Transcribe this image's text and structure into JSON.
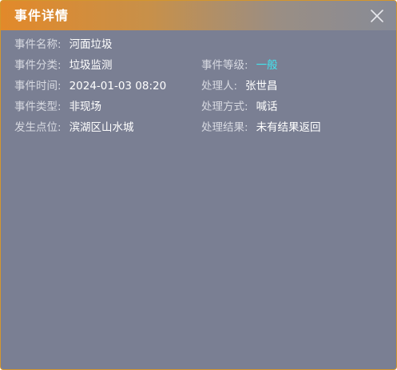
{
  "dialog": {
    "title": "事件详情",
    "close_icon": "close-icon",
    "accent_color": "#41e6f0",
    "header_color": "#e2892a"
  },
  "fields": {
    "event_name": {
      "label": "事件名称:",
      "value": "河面垃圾"
    },
    "event_category": {
      "label": "事件分类:",
      "value": "垃圾监测"
    },
    "event_level": {
      "label": "事件等级:",
      "value": "一般"
    },
    "event_time": {
      "label": "事件时间:",
      "value": "2024-01-03 08:20"
    },
    "handler": {
      "label": "处理人:",
      "value": "张世昌"
    },
    "event_type": {
      "label": "事件类型:",
      "value": "非现场"
    },
    "handle_method": {
      "label": "处理方式:",
      "value": "喊话"
    },
    "location": {
      "label": "发生点位:",
      "value": "滨湖区山水城"
    },
    "handle_result": {
      "label": "处理结果:",
      "value": "未有结果返回"
    }
  }
}
